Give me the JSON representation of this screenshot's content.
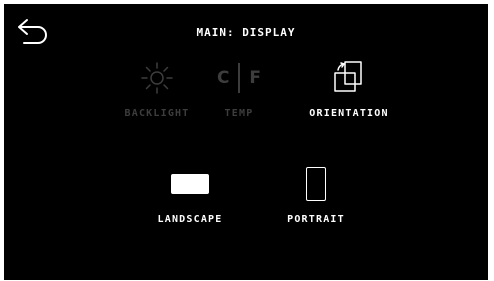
{
  "header": {
    "title": "MAIN: DISPLAY"
  },
  "back_button": {
    "icon": "back-arrow-icon"
  },
  "menu": {
    "items": [
      {
        "label": "BACKLIGHT",
        "icon": "sun-icon",
        "state": "inactive"
      },
      {
        "label": "TEMP",
        "icon": "celsius-fahrenheit-icon",
        "state": "inactive",
        "left_text": "C",
        "right_text": "F"
      },
      {
        "label": "ORIENTATION",
        "icon": "rotate-screens-icon",
        "state": "active"
      }
    ]
  },
  "orientation_options": [
    {
      "label": "LANDSCAPE",
      "icon": "landscape-icon"
    },
    {
      "label": "PORTRAIT",
      "icon": "portrait-icon"
    }
  ],
  "colors": {
    "background": "#000000",
    "active": "#ffffff",
    "inactive": "#3d3d3d"
  }
}
